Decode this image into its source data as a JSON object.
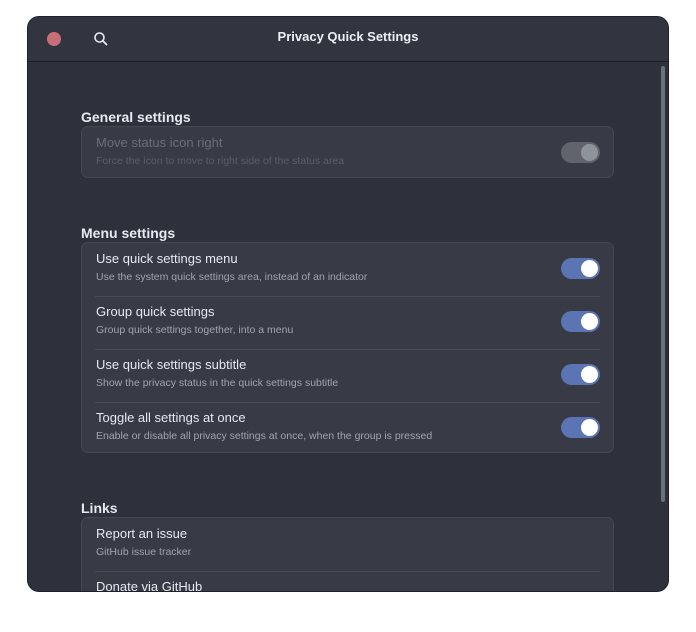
{
  "window": {
    "title": "Privacy Quick Settings"
  },
  "header": {
    "close_icon": "close-icon",
    "search_icon": "search-icon"
  },
  "sections": {
    "general": {
      "title": "General settings",
      "rows": [
        {
          "title": "Move status icon right",
          "subtitle": "Force the icon to move to right side of the status area",
          "enabled": false,
          "on": true
        }
      ]
    },
    "menu": {
      "title": "Menu settings",
      "rows": [
        {
          "title": "Use quick settings menu",
          "subtitle": "Use the system quick settings area, instead of an indicator",
          "on": true
        },
        {
          "title": "Group quick settings",
          "subtitle": "Group quick settings together, into a menu",
          "on": true
        },
        {
          "title": "Use quick settings subtitle",
          "subtitle": "Show the privacy status in the quick settings subtitle",
          "on": true
        },
        {
          "title": "Toggle all settings at once",
          "subtitle": "Enable or disable all privacy settings at once, when the group is pressed",
          "on": true
        }
      ]
    },
    "links": {
      "title": "Links",
      "rows": [
        {
          "title": "Report an issue",
          "subtitle": "GitHub issue tracker"
        },
        {
          "title": "Donate via GitHub",
          "subtitle": ""
        }
      ]
    }
  },
  "colors": {
    "accent": "#5a74b4",
    "close": "#c76e78",
    "background": "#2e313b",
    "card": "#383b46"
  }
}
